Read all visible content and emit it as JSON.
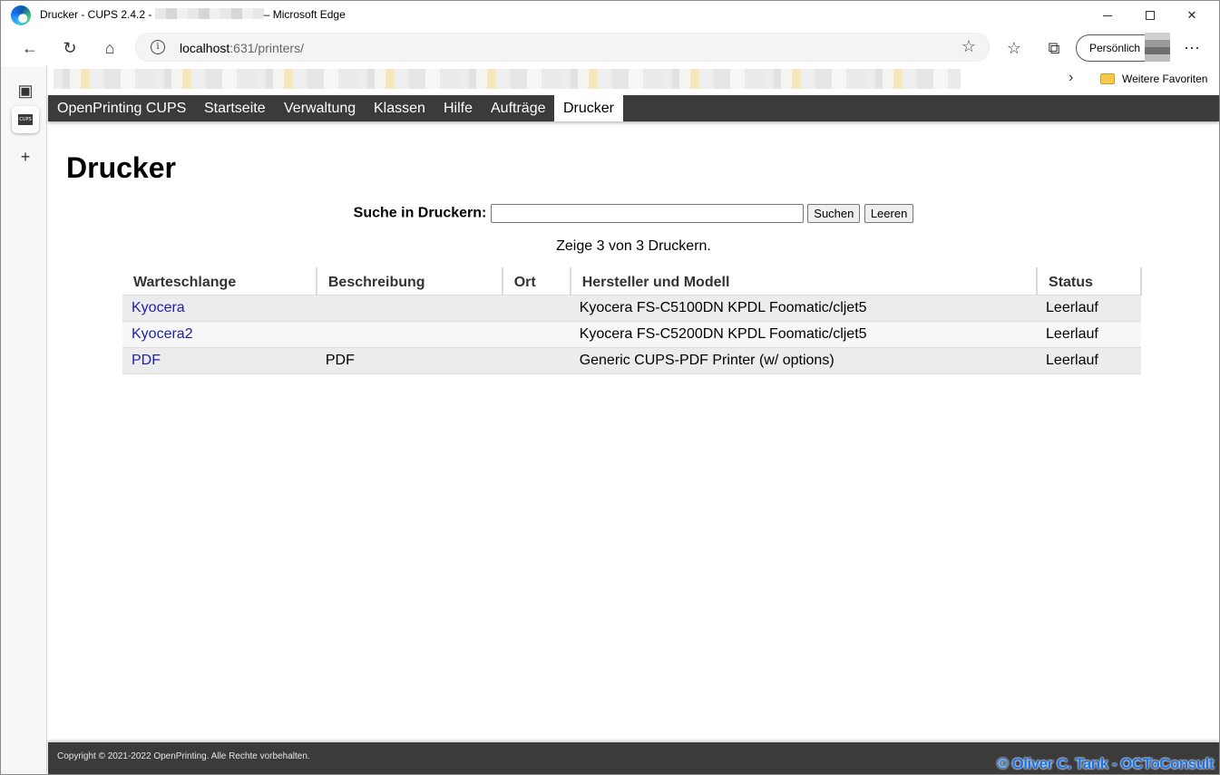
{
  "window": {
    "title_prefix": "Drucker - CUPS 2.4.2 -",
    "title_suffix": "– Microsoft Edge"
  },
  "addressbar": {
    "host": "localhost",
    "path": ":631/printers/"
  },
  "profile": {
    "label": "Persönlich"
  },
  "favorites": {
    "more_label": "Weitere Favoriten"
  },
  "nav": {
    "items": [
      {
        "label": "OpenPrinting CUPS"
      },
      {
        "label": "Startseite"
      },
      {
        "label": "Verwaltung"
      },
      {
        "label": "Klassen"
      },
      {
        "label": "Hilfe"
      },
      {
        "label": "Aufträge"
      },
      {
        "label": "Drucker"
      }
    ]
  },
  "page": {
    "title": "Drucker",
    "search_label": "Suche in Druckern:",
    "search_value": "",
    "search_button": "Suchen",
    "clear_button": "Leeren",
    "count_text": "Zeige 3 von 3 Druckern."
  },
  "table": {
    "headers": [
      "Warteschlange",
      "Beschreibung",
      "Ort",
      "Hersteller und Modell",
      "Status"
    ],
    "rows": [
      {
        "queue": "Kyocera",
        "description": "",
        "location": "",
        "model": "Kyocera FS-C5100DN KPDL Foomatic/cljet5",
        "status": "Leerlauf"
      },
      {
        "queue": "Kyocera2",
        "description": "",
        "location": "",
        "model": "Kyocera FS-C5200DN KPDL Foomatic/cljet5",
        "status": "Leerlauf"
      },
      {
        "queue": "PDF",
        "description": "PDF",
        "location": "",
        "model": "Generic CUPS-PDF Printer (w/ options)",
        "status": "Leerlauf"
      }
    ]
  },
  "footer": {
    "copyright": "Copyright © 2021-2022 OpenPrinting. Alle Rechte vorbehalten.",
    "credit": "© Oliver C. Tank - OCToConsult"
  },
  "colors": {
    "nav_bg": "#3b3b3b",
    "link": "#1f1fa8",
    "row_odd": "#ececec",
    "row_even": "#f7f7f7"
  }
}
